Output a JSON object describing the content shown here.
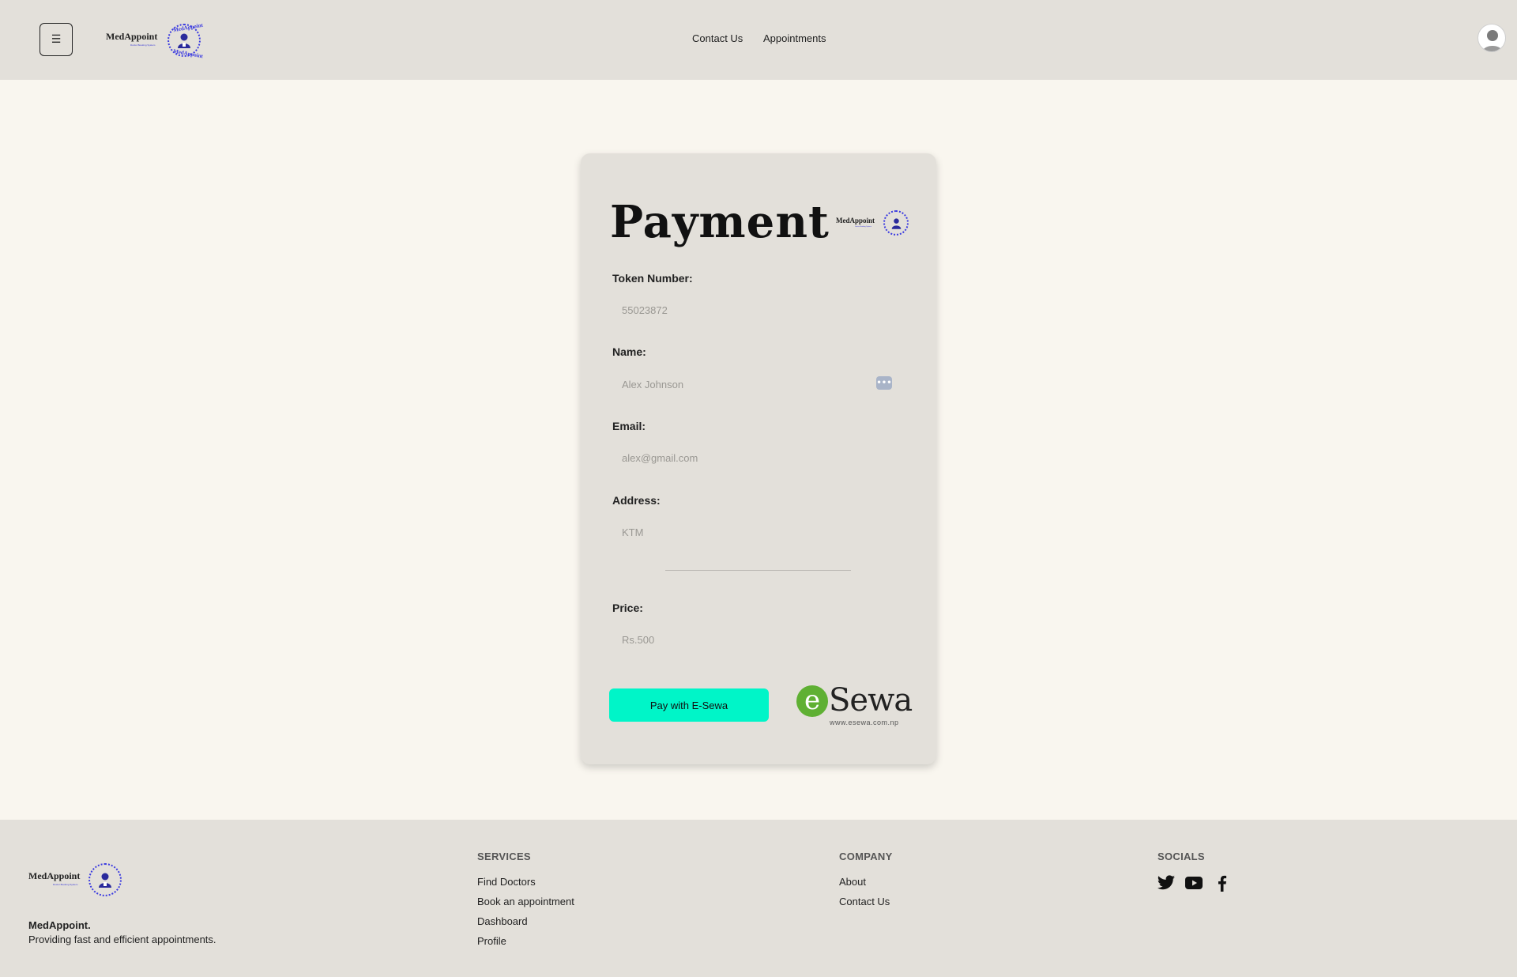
{
  "header": {
    "menu_glyph": "☰",
    "brand": "MedAppoint",
    "brand_tagline": "Doctor Booking System",
    "seal_text": "MedAppoint",
    "nav": [
      "Contact Us",
      "Appointments"
    ]
  },
  "form": {
    "title": "Payment",
    "fields": [
      {
        "label": "Token Number:",
        "value": "55023872"
      },
      {
        "label": "Name:",
        "value": "Alex Johnson"
      },
      {
        "label": "Email:",
        "value": "alex@gmail.com"
      },
      {
        "label": "Address:",
        "value": "KTM"
      },
      {
        "label": "Price:",
        "value": "Rs.500"
      }
    ],
    "pay_button": "Pay with E-Sewa"
  },
  "esewa": {
    "e": "e",
    "sewa": "Sewa",
    "url": "www.esewa.com.np"
  },
  "footer": {
    "name": "MedAppoint.",
    "tagline": "Providing fast and efficient appointments.",
    "services": {
      "heading": "SERVICES",
      "links": [
        "Find Doctors",
        "Book an appointment",
        "Dashboard",
        "Profile"
      ]
    },
    "company": {
      "heading": "COMPANY",
      "links": [
        "About",
        "Contact Us"
      ]
    },
    "socials": {
      "heading": "SOCIALS",
      "icons": [
        "twitter-icon",
        "youtube-icon",
        "facebook-icon"
      ]
    }
  },
  "colors": {
    "header_bg": "#e3e0da",
    "page_bg": "#f9f6ef",
    "accent_button": "#00f5c8",
    "brand_blue": "#3b3be0",
    "esewa_green": "#5fb033"
  }
}
